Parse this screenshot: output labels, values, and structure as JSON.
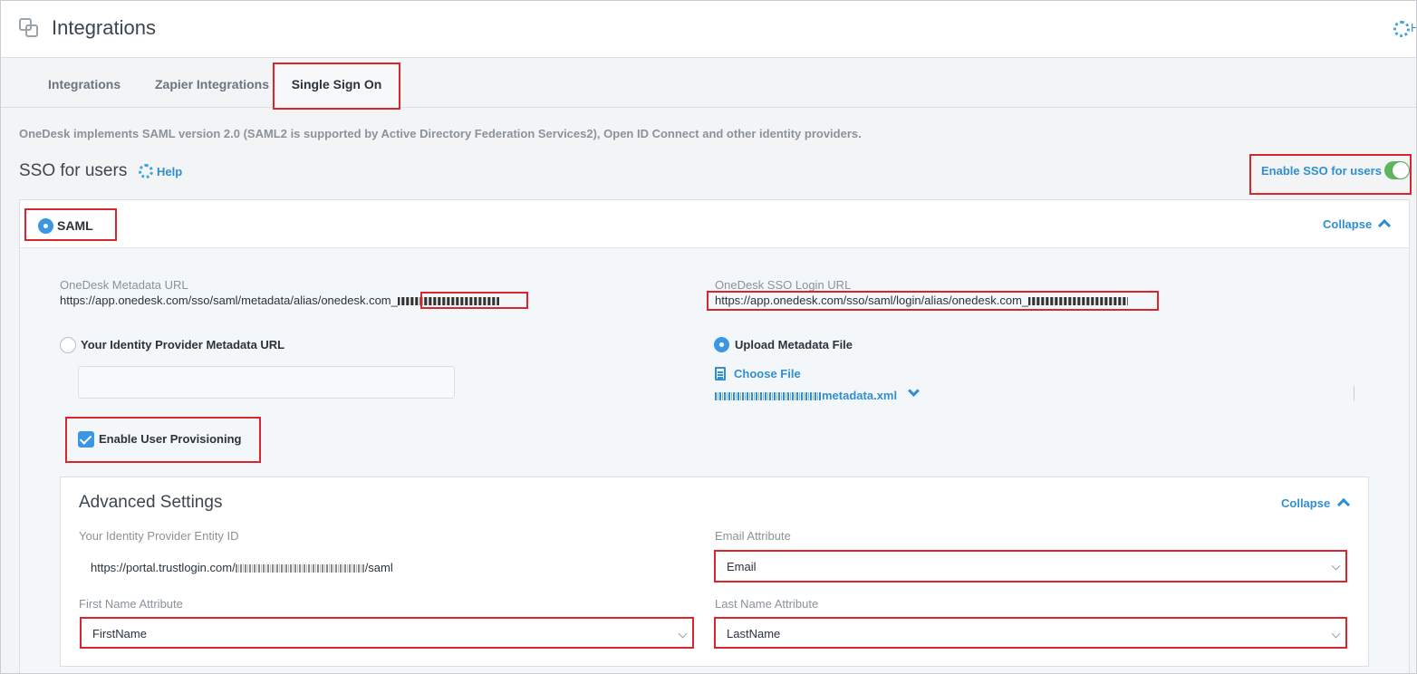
{
  "header": {
    "title": "Integrations",
    "help_partial": "H"
  },
  "tabs": [
    "Integrations",
    "Zapier Integrations",
    "Single Sign On"
  ],
  "description": "OneDesk implements SAML version 2.0 (SAML2 is supported by Active Directory Federation Services2), Open ID Connect and other identity providers.",
  "sso": {
    "title": "SSO for users",
    "help_label": "Help",
    "enable_label": "Enable SSO for users",
    "enabled": true
  },
  "saml": {
    "label": "SAML",
    "collapse_label": "Collapse",
    "metadata_url_label": "OneDesk Metadata URL",
    "metadata_url_value": "https://app.onedesk.com/sso/saml/metadata/alias/onedesk.com_",
    "login_url_label": "OneDesk SSO Login URL",
    "login_url_value": "https://app.onedesk.com/sso/saml/login/alias/onedesk.com_",
    "idp_metadata_label": "Your Identity Provider Metadata URL",
    "idp_metadata_value": "",
    "upload_label": "Upload Metadata File",
    "choose_file_label": "Choose File",
    "file_name_suffix": "metadata.xml",
    "provisioning_label": "Enable User Provisioning",
    "provisioning_checked": true
  },
  "advanced": {
    "title": "Advanced Settings",
    "collapse_label": "Collapse",
    "entity_id_label": "Your Identity Provider Entity ID",
    "entity_id_prefix": "https://portal.trustlogin.com/",
    "entity_id_suffix": "/saml",
    "email_label": "Email Attribute",
    "email_value": "Email",
    "first_name_label": "First Name Attribute",
    "first_name_value": "FirstName",
    "last_name_label": "Last Name Attribute",
    "last_name_value": "LastName"
  },
  "colors": {
    "accent": "#2f8fcf",
    "highlight": "#d9252e",
    "toggle_on": "#5cb85c",
    "radio": "#3b97e3"
  },
  "icons": [
    "integrations-icon",
    "help-icon",
    "file-icon",
    "chevron-up-icon",
    "chevron-down-icon",
    "check-icon"
  ]
}
